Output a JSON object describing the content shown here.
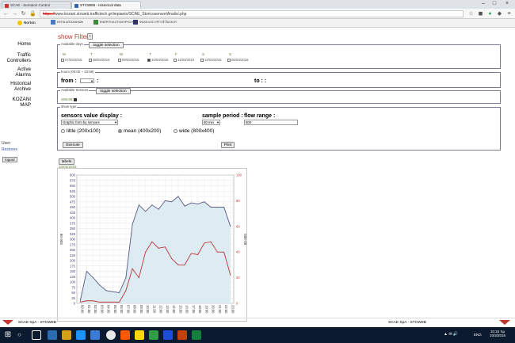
{
  "browser": {
    "tabs": [
      {
        "title": "SCAE - Sematori Control"
      },
      {
        "title": "STCWEB - Historical data"
      }
    ],
    "url_scheme": "https://",
    "url_rest": "www.kozani.stcweb.traffictech.gr/impianto/SCAE_StoricosensoriAnalisi.php",
    "bookmarks": [
      {
        "label": "Norton"
      },
      {
        "label": "ΚΕΠΑ ΑΠΟΔΗΜΩΝ"
      },
      {
        "label": "ΕΝΕΡΓΕΙΑ ΕΠΙΧΕΙΡΗΣΗΣ"
      },
      {
        "label": "ΦΑΚΕΛΟΣ ΕΡΓΟΥ ΤΑΣΚΟΥ"
      }
    ]
  },
  "sidebar": {
    "items": [
      {
        "label": "Home"
      },
      {
        "label": "Traffic Controllers"
      },
      {
        "label": "Active Alarms"
      },
      {
        "label": "Historical Archive"
      },
      {
        "label": "KOZANI MAP"
      }
    ],
    "user_label": "User:",
    "user_link": "Restores",
    "logout": "logout"
  },
  "filter": {
    "show_filter": "show Filter",
    "toggle_icon": "!",
    "days_legend": "Available days",
    "toggle_selection": "toggle selection",
    "days": [
      {
        "letter": "M",
        "date": "07/03/2016",
        "checked": false
      },
      {
        "letter": "T",
        "date": "08/03/2016",
        "checked": false
      },
      {
        "letter": "W",
        "date": "09/03/2016",
        "checked": false
      },
      {
        "letter": "T",
        "date": "10/03/2016",
        "checked": true
      },
      {
        "letter": "F",
        "date": "11/03/2016",
        "checked": false
      },
      {
        "letter": "S",
        "date": "12/03/2016",
        "checked": false
      },
      {
        "letter": "S",
        "date": "06/03/2016",
        "checked": false
      }
    ],
    "hours_legend": "hours (00:00 -- 23:59)",
    "from_label": "from :",
    "from_colon": ":",
    "to_label": "to : :",
    "sensors_legend": "Available Sensors",
    "sensor_name": "S06-08",
    "show_type_legend": "show type",
    "value_display_label": "sensors value display :",
    "value_display_selected": "Graphic form by sensors",
    "sample_period_label": "sample period :",
    "sample_period_selected": "60 min",
    "flow_range_label": "flow range :",
    "flow_range_value": "600",
    "sizes": [
      {
        "label": "little (200x100)",
        "selected": false
      },
      {
        "label": "mean (400x200)",
        "selected": true
      },
      {
        "label": "wide (800x400)",
        "selected": false
      }
    ],
    "execute": "Execute",
    "print": "Print"
  },
  "chart_area": {
    "labels_button": "labels",
    "date_label": "10/03/2016"
  },
  "chart_data": {
    "type": "line",
    "x": [
      "00:00",
      "01:00",
      "02:00",
      "03:00",
      "04:00",
      "05:00",
      "06:00",
      "07:00",
      "08:00",
      "09:00",
      "10:00",
      "11:00",
      "12:00",
      "13:00",
      "14:00",
      "15:00",
      "16:00",
      "17:00",
      "18:00",
      "19:00",
      "20:00",
      "21:00",
      "22:00",
      "23:00"
    ],
    "series": [
      {
        "name": "flow",
        "axis": "left",
        "color": "#5a5a80",
        "values": [
          10,
          150,
          120,
          85,
          60,
          55,
          50,
          120,
          370,
          460,
          430,
          460,
          440,
          480,
          475,
          500,
          455,
          470,
          465,
          475,
          450,
          450,
          450,
          360
        ]
      },
      {
        "name": "occupancy",
        "axis": "right",
        "color": "#c03535",
        "values": [
          1,
          2,
          2,
          1,
          1,
          1,
          1,
          10,
          27,
          20,
          40,
          48,
          43,
          44,
          35,
          30,
          30,
          39,
          38,
          47,
          48,
          40,
          40,
          22
        ]
      }
    ],
    "ylim_left": [
      0,
      600
    ],
    "yticks_left": [
      0,
      25,
      50,
      75,
      100,
      125,
      150,
      175,
      200,
      225,
      250,
      275,
      300,
      325,
      350,
      375,
      400,
      425,
      450,
      475,
      500,
      525,
      550,
      575,
      600
    ],
    "ylim_right": [
      0,
      100
    ],
    "yticks_right": [
      0,
      20,
      40,
      60,
      80,
      100
    ],
    "ylabel_left": "S06-08",
    "ylabel_right": "S06-08",
    "grid": true,
    "fill_under_flow": true
  },
  "footer": {
    "left": "SCAE SpA - STCWEB",
    "right": "SCAE SpA - STCWEB"
  },
  "taskbar": {
    "time": "10:15 πμ",
    "date": "10/3/2016",
    "lang": "ENG"
  },
  "colors": {
    "accent": "#c0392b",
    "link": "#3355aa",
    "flow_fill": "#dcecf2",
    "taskbar": "#0b1a2e"
  }
}
